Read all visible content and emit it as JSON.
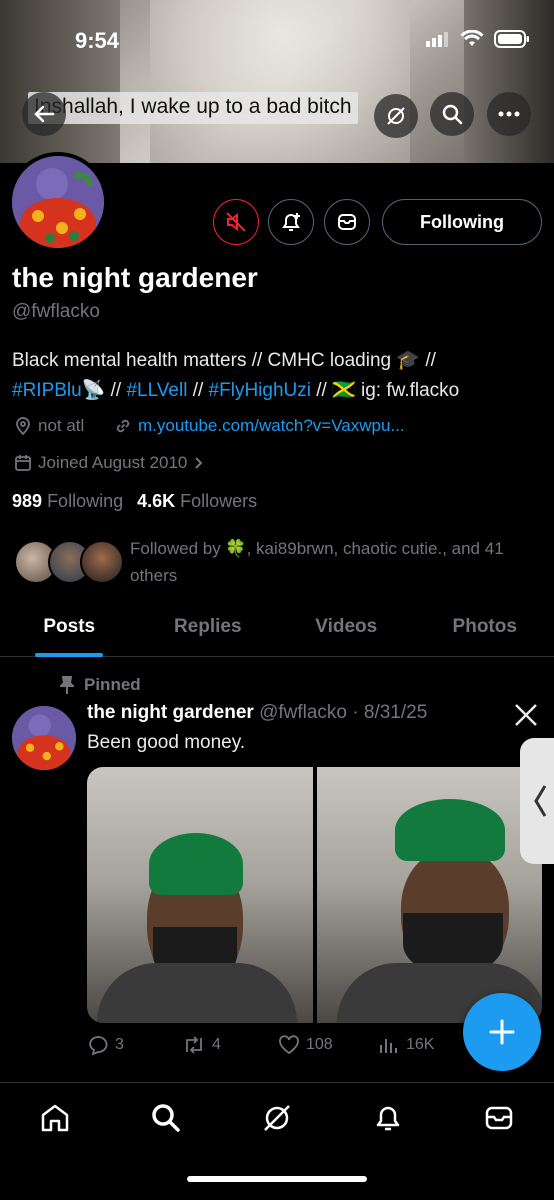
{
  "status_bar": {
    "time": "9:54"
  },
  "header": {
    "video_caption": "Inshallah, I wake up to a bad bitch"
  },
  "profile": {
    "following_button": "Following",
    "name": "the night gardener",
    "handle": "@fwflacko",
    "bio_line1": "Black mental health matters // CMHC loading 🎓 //",
    "bio_line2_parts": [
      "#RIPBlu",
      "📡 // ",
      "#LLVell",
      " // ",
      "#FlyHighUzi",
      " // 🇯🇲 ig: fw.flacko"
    ],
    "location": "not atl",
    "website": "m.youtube.com/watch?v=Vaxwpu...",
    "joined": "Joined August 2010",
    "following_count": "989",
    "following_label": "Following",
    "followers_count": "4.6K",
    "followers_label": "Followers",
    "followed_by": "Followed by 🍀, kai89brwn, chaotic cutie., and 41 others"
  },
  "tabs": [
    "Posts",
    "Replies",
    "Videos",
    "Photos"
  ],
  "post": {
    "pinned_label": "Pinned",
    "author": "the night gardener",
    "handle_date": "@fwflacko · 8/31/25",
    "text": "Been good money.",
    "replies": "3",
    "reposts": "4",
    "likes": "108",
    "views": "16K"
  },
  "colors": {
    "accent": "#1d9bf0",
    "background": "#000000",
    "muted": "#71767b",
    "mute_icon": "#f4212e"
  }
}
